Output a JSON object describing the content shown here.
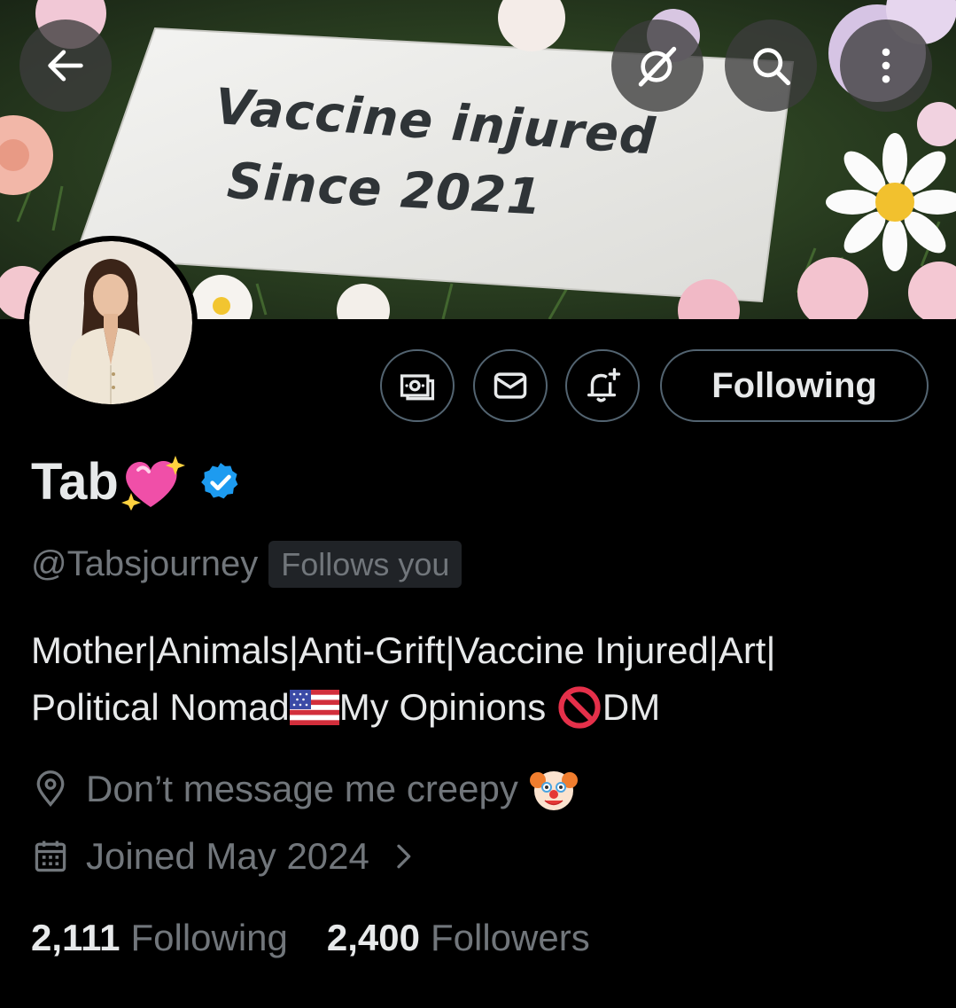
{
  "banner": {
    "sign_line1": "Vaccine injured",
    "sign_line2": "Since 2021"
  },
  "header_buttons": {
    "back_icon": "arrow-left-icon",
    "grok_icon": "grok-icon",
    "search_icon": "search-icon",
    "more_icon": "more-vertical-icon"
  },
  "actions": {
    "tip_icon": "money-icon",
    "message_icon": "envelope-icon",
    "notify_icon": "bell-plus-icon",
    "follow_label": "Following"
  },
  "profile": {
    "display_name": "Tab",
    "name_emoji": "sparkling-heart",
    "verified": true,
    "handle": "@Tabsjourney",
    "follows_you": "Follows you",
    "bio_line1": "Mother|Animals|Anti-Grift|Vaccine Injured|Art|",
    "bio_line2_part1": "Political Nomad",
    "bio_line2_part2": "My Opinions ",
    "bio_line2_part3": "DM",
    "location": "Don’t message me creepy",
    "joined": "Joined May 2024"
  },
  "stats": {
    "following_count": "2,111",
    "following_label": "Following",
    "followers_count": "2,400",
    "followers_label": "Followers"
  },
  "colors": {
    "background": "#000000",
    "text_primary": "#e7e9ea",
    "text_secondary": "#71767b",
    "border": "#536471",
    "verified_blue": "#1d9bf0"
  }
}
